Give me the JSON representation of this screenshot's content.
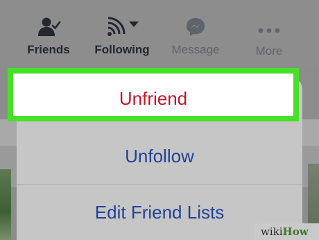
{
  "actions": [
    {
      "label": "Friends",
      "icon": "friends-check-icon"
    },
    {
      "label": "Following",
      "icon": "rss-following-icon"
    },
    {
      "label": "Message",
      "icon": "messenger-icon"
    },
    {
      "label": "More",
      "icon": "more-dots-icon"
    }
  ],
  "menu": {
    "unfriend": "Unfriend",
    "unfollow": "Unfollow",
    "edit_friend_lists": "Edit Friend Lists"
  },
  "watermark": {
    "part1": "wiki",
    "part2": "How"
  },
  "colors": {
    "highlight": "#46e126",
    "danger_text": "#c4162a",
    "link_text": "#23419a"
  }
}
